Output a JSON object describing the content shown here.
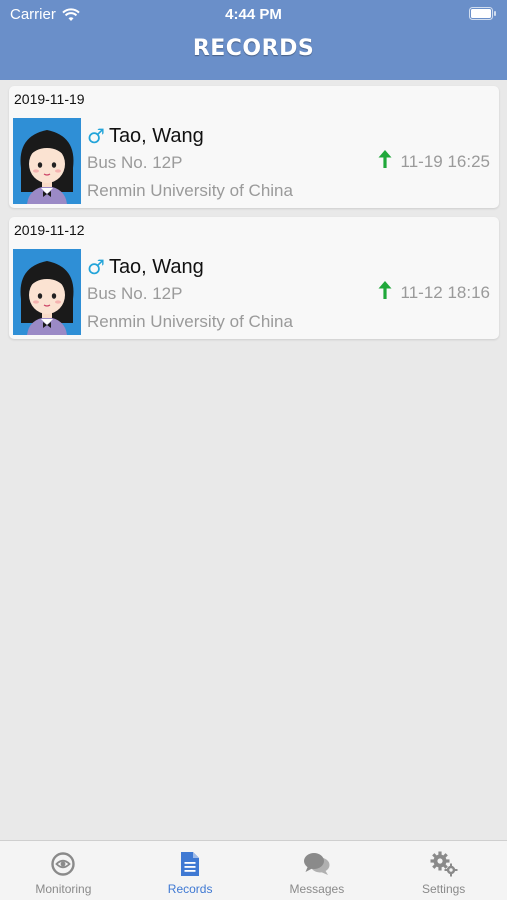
{
  "status_bar": {
    "carrier": "Carrier",
    "time": "4:44 PM"
  },
  "header": {
    "title": "RECORDS"
  },
  "records": [
    {
      "date": "2019-11-19",
      "gender_symbol": "♂",
      "name": "Tao, Wang",
      "bus": "Bus No. 12P",
      "school": "Renmin University of China",
      "time": "11-19 16:25"
    },
    {
      "date": "2019-11-12",
      "gender_symbol": "♂",
      "name": "Tao, Wang",
      "bus": "Bus No. 12P",
      "school": "Renmin University of China",
      "time": "11-12 18:16"
    }
  ],
  "tabs": [
    {
      "label": "Monitoring",
      "icon": "monitoring-icon"
    },
    {
      "label": "Records",
      "icon": "records-icon",
      "active": true
    },
    {
      "label": "Messages",
      "icon": "messages-icon"
    },
    {
      "label": "Settings",
      "icon": "settings-icon"
    }
  ],
  "colors": {
    "header": "#6a8fc9",
    "active_tab": "#3f79d3",
    "up_arrow": "#1fa83a",
    "gender": "#23a4d9"
  }
}
